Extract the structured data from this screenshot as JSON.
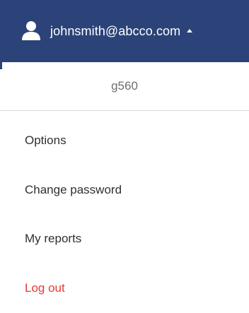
{
  "header": {
    "user_icon": "user-icon",
    "email": "johnsmith@abcco.com",
    "caret_icon": "caret-up-icon",
    "background_color": "#2b4378"
  },
  "dropdown": {
    "account_id": "g560",
    "items": [
      {
        "label": "Options"
      },
      {
        "label": "Change password"
      },
      {
        "label": "My reports"
      },
      {
        "label": "Log out",
        "color": "#e53935"
      }
    ]
  }
}
